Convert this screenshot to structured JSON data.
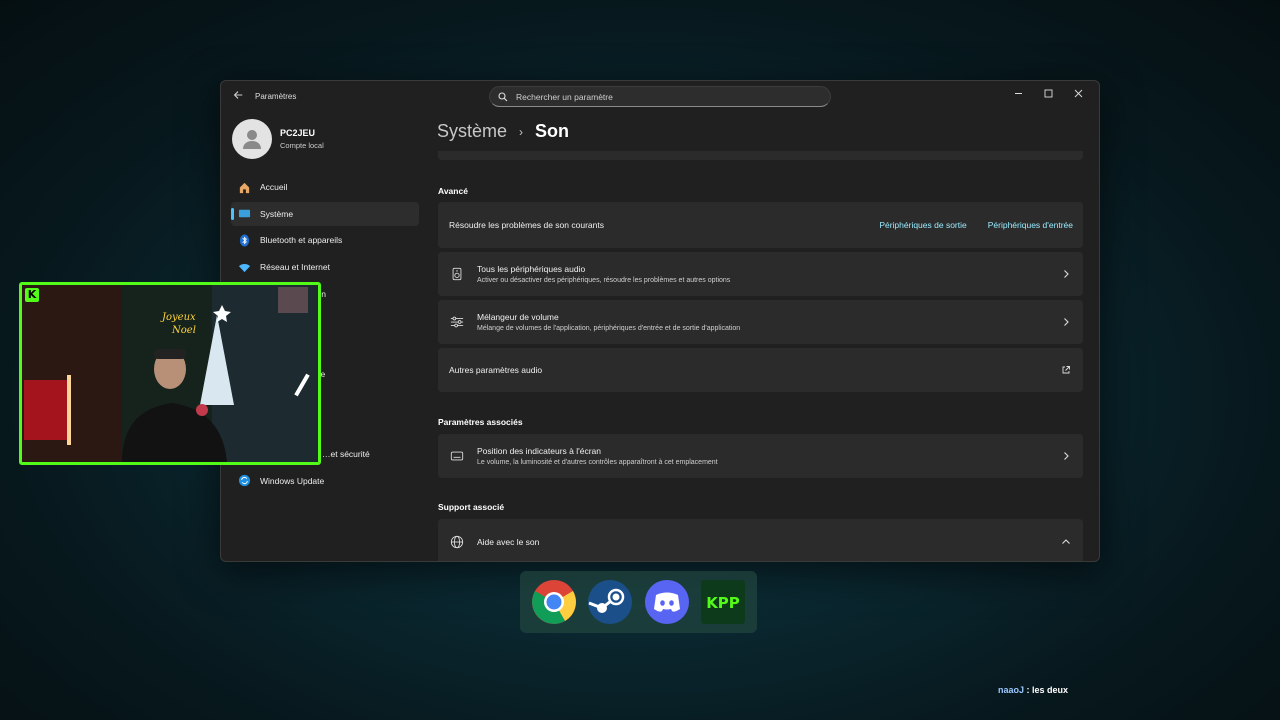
{
  "window": {
    "app_title": "Paramètres",
    "search_placeholder": "Rechercher un paramètre"
  },
  "user": {
    "name": "PC2JEU",
    "account_type": "Compte local"
  },
  "sidebar": {
    "items": [
      {
        "label": "Accueil",
        "icon": "home-icon"
      },
      {
        "label": "Système",
        "icon": "system-icon",
        "active": true
      },
      {
        "label": "Bluetooth et appareils",
        "icon": "bluetooth-icon"
      },
      {
        "label": "Réseau et Internet",
        "icon": "wifi-icon"
      },
      {
        "label": "…on",
        "icon": "personalization-icon"
      },
      {
        "label": "",
        "icon": "apps-icon"
      },
      {
        "label": "",
        "icon": "accounts-icon"
      },
      {
        "label": "…e",
        "icon": "time-language-icon"
      },
      {
        "label": "",
        "icon": "gaming-icon"
      },
      {
        "label": "",
        "icon": "accessibility-icon"
      },
      {
        "label": "…et sécurité",
        "icon": "privacy-security-icon"
      },
      {
        "label": "Windows Update",
        "icon": "windows-update-icon"
      }
    ]
  },
  "breadcrumb": {
    "parent": "Système",
    "separator": "›",
    "current": "Son"
  },
  "sections": {
    "advanced": {
      "title": "Avancé",
      "troubleshoot": {
        "title": "Résoudre les problèmes de son courants",
        "link_output": "Périphériques de sortie",
        "link_input": "Périphériques d'entrée"
      },
      "all_devices": {
        "title": "Tous les périphériques audio",
        "subtitle": "Activer ou désactiver des périphériques, résoudre les problèmes et autres options"
      },
      "mixer": {
        "title": "Mélangeur de volume",
        "subtitle": "Mélange de volumes de l'application, périphériques d'entrée et de sortie d'application"
      },
      "more_audio": {
        "title": "Autres paramètres audio"
      }
    },
    "related": {
      "title": "Paramètres associés",
      "indicator": {
        "title": "Position des indicateurs à l'écran",
        "subtitle": "Le volume, la luminosité et d'autres contrôles apparaîtront à cet emplacement"
      }
    },
    "support": {
      "title": "Support associé",
      "help": {
        "title": "Aide avec le son"
      }
    }
  },
  "overlay": {
    "webcam_logo": "K",
    "dock_icons": [
      "chrome-icon",
      "steam-icon",
      "discord-icon",
      "kpp-icon"
    ],
    "dock_kpp_text": "KPP",
    "chat": {
      "user": "naaoJ",
      "separator": " : ",
      "message": "les deux"
    }
  },
  "colors": {
    "accent": "#4cc2ff",
    "link": "#99ebff",
    "kick_green": "#53fc18"
  }
}
